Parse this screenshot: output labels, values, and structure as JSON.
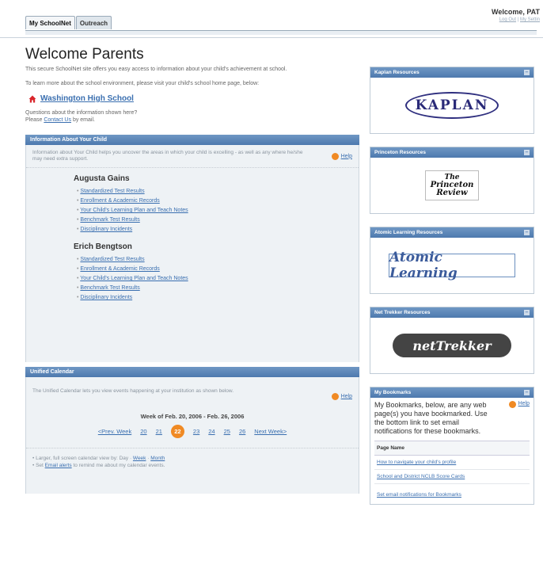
{
  "tabs": [
    {
      "label": "My SchoolNet",
      "active": true
    },
    {
      "label": "Outreach",
      "active": false
    }
  ],
  "header": {
    "welcome": "Welcome, PAT",
    "logout": "Log Out",
    "settings": "My Settin"
  },
  "main": {
    "title": "Welcome Parents",
    "intro1": "This secure SchoolNet site offers you easy access to information about your child's achievement at school.",
    "intro2": "To learn more about the school environment, please visit your child's school home page, below:",
    "school_link": "Washington High School",
    "questions_prefix": "Questions about the information shown here?",
    "please": "Please",
    "contact_link": "Contact Us",
    "questions_suffix": "by email."
  },
  "child_section": {
    "header": "Information About Your Child",
    "desc": "Information about Your Child helps you uncover the areas in which your child is excelling - as well as any where he/she may need extra support.",
    "help": "Help",
    "children": [
      {
        "name": "Augusta Gains",
        "links": [
          "Standardized Test Results",
          "Enrollment & Academic Records",
          "Your Child's Learning Plan and Teach Notes",
          "Benchmark Test Results",
          "Disciplinary Incidents"
        ]
      },
      {
        "name": "Erich Bengtson",
        "links": [
          "Standardized Test Results",
          "Enrollment & Academic Records",
          "Your Child's Learning Plan and Teach Notes",
          "Benchmark Test Results",
          "Disciplinary Incidents"
        ]
      }
    ]
  },
  "calendar": {
    "header": "Unified Calendar",
    "desc": "The Unified Calendar lets you view events happening at your institution as shown below.",
    "help": "Help",
    "week_title": "Week of Feb. 20, 2006 - Feb. 26, 2006",
    "prev": "<Prev. Week",
    "next": "Next Week>",
    "days": [
      "20",
      "21",
      "22",
      "23",
      "24",
      "25",
      "26"
    ],
    "today": "22",
    "line1_prefix": "• Larger, full screen calendar view by: Day ·",
    "week_link": "Week",
    "month_link": "Month",
    "line2_prefix": "• Set",
    "email_alerts_link": "Email alerts",
    "line2_suffix": "to remind me about my calendar events."
  },
  "resources": [
    {
      "header": "Kaplan Resources",
      "logo": "KAPLAN",
      "logo_style": "kaplan"
    },
    {
      "header": "Princeton Resources",
      "logo_lines": [
        "The",
        "Princeton",
        "Review"
      ],
      "logo_style": "princeton"
    },
    {
      "header": "Atomic Learning Resources",
      "logo": "Atomic Learning",
      "logo_style": "atomic"
    },
    {
      "header": "Net Trekker Resources",
      "logo": "netTrekker",
      "logo_style": "nettrekker"
    }
  ],
  "bookmarks": {
    "header": "My Bookmarks",
    "intro": "My Bookmarks, below, are any web page(s) you have bookmarked. Use the bottom link to set email notifications for these bookmarks.",
    "help": "Help",
    "column": "Page Name",
    "rows": [
      "How to navigate your child's profile",
      "School and District NCLB Score Cards"
    ],
    "footer_link": "Set email notifications for Bookmarks"
  },
  "colors": {
    "section_header": "#4d79ae",
    "help_icon": "#f08a24",
    "link": "#3a6fb0",
    "school_icon": "#d9262c"
  }
}
